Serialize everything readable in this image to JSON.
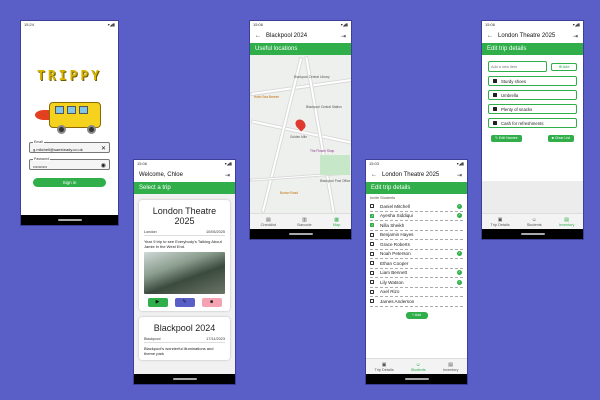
{
  "login": {
    "status_time": "15:24",
    "logo": "TRIPPY",
    "email_label": "Email",
    "email_value": "g.mitchell@sambeady.co.uk",
    "password_label": "Password",
    "password_value": "••••••••••",
    "signin_label": "Sign in"
  },
  "trips": {
    "status_time": "15:06",
    "welcome": "Welcome, Chloe",
    "section": "Select a trip",
    "cards": [
      {
        "title": "London Theatre 2025",
        "location": "London",
        "date": "10/05/2025",
        "description": "Year 9 trip to see Everybody's Talking About Jamie in the West End."
      },
      {
        "title": "Blackpool 2024",
        "location": "Blackpool",
        "date": "17/11/2023",
        "description": "Blackpool's wonderful illuminations and theme park"
      }
    ]
  },
  "map": {
    "status_time": "15:06",
    "title": "Blackpool 2024",
    "section": "Useful locations",
    "labels": {
      "l1": "Blackpool Central Library",
      "l2": "Hotel Sea Breeze",
      "l3": "Blackpool Central Station",
      "l4": "Golden Mile",
      "l5": "The Flower Shop",
      "l6": "Blackpool Post Office",
      "l7": "Burton Road"
    },
    "nav": [
      "Checklist",
      "Barcode",
      "Map"
    ]
  },
  "students": {
    "status_time": "15:03",
    "title": "London Theatre 2025",
    "section": "Edit trip details",
    "header": "Invite Students",
    "list": [
      {
        "name": "Daniel Mitchell",
        "checked": false,
        "ok": true
      },
      {
        "name": "Ayesha Siddiqui",
        "checked": true,
        "ok": true
      },
      {
        "name": "Nilla Sheikh",
        "checked": true,
        "ok": false
      },
      {
        "name": "Benjamin Hayes",
        "checked": false,
        "ok": false
      },
      {
        "name": "Grace Roberts",
        "checked": false,
        "ok": false
      },
      {
        "name": "Noah Peterson",
        "checked": false,
        "ok": true
      },
      {
        "name": "Ethan Cooper",
        "checked": false,
        "ok": false
      },
      {
        "name": "Liam Bennett",
        "checked": false,
        "ok": true
      },
      {
        "name": "Lily Watson",
        "checked": false,
        "ok": true
      },
      {
        "name": "Axel Rizo",
        "checked": false,
        "ok": false
      },
      {
        "name": "James Anderson",
        "checked": false,
        "ok": false
      }
    ],
    "add_label": "+ Add",
    "nav": [
      "Trip Details",
      "Students",
      "Inventory"
    ]
  },
  "inventory": {
    "status_time": "15:06",
    "title": "London Theatre 2025",
    "section": "Edit trip details",
    "placeholder": "Add a new item",
    "add_label": "Add",
    "items": [
      "Sturdy shoes",
      "Umbrella",
      "Plenty of snacks",
      "Cash for refreshments"
    ],
    "edit_label": "Edit Names",
    "clear_label": "Clear List",
    "nav": [
      "Trip Details",
      "Students",
      "Inventory"
    ]
  },
  "colors": {
    "background": "#5a5fc8",
    "accent": "#2fae4a",
    "logo": "#d8b400"
  }
}
